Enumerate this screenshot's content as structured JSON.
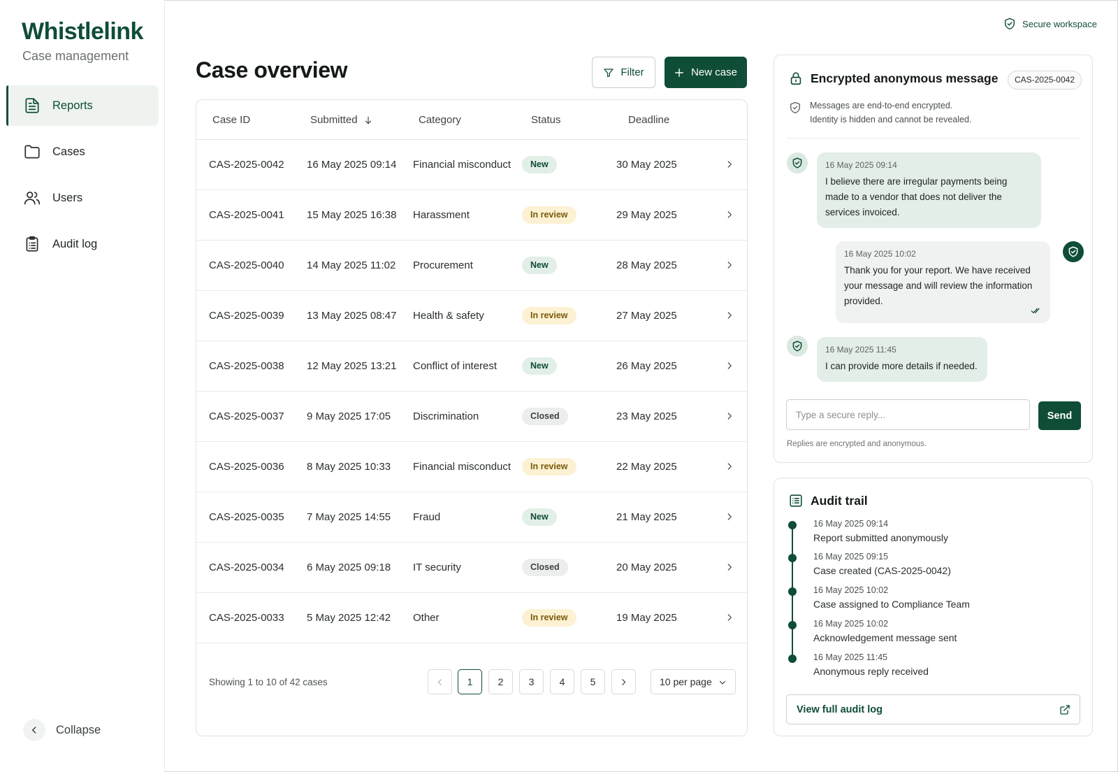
{
  "brand": {
    "name": "Whistlelink",
    "subtitle": "Case management"
  },
  "sidebar": {
    "items": [
      {
        "label": "Reports",
        "icon": "file-text-icon",
        "active": true
      },
      {
        "label": "Cases",
        "icon": "folder-icon"
      },
      {
        "label": "Users",
        "icon": "users-icon"
      },
      {
        "label": "Audit log",
        "icon": "clipboard-icon"
      }
    ],
    "collapse_label": "Collapse"
  },
  "header": {
    "secure_label": "Secure workspace"
  },
  "main": {
    "title": "Case overview",
    "filter_label": "Filter",
    "new_case_label": "New case",
    "columns": [
      "Case ID",
      "Submitted",
      "Category",
      "Status",
      "Deadline"
    ],
    "rows": [
      {
        "id": "CAS-2025-0042",
        "submitted": "16 May 2025 09:14",
        "category": "Financial misconduct",
        "status": "New",
        "deadline": "30 May 2025"
      },
      {
        "id": "CAS-2025-0041",
        "submitted": "15 May 2025 16:38",
        "category": "Harassment",
        "status": "In review",
        "deadline": "29 May 2025"
      },
      {
        "id": "CAS-2025-0040",
        "submitted": "14 May 2025 11:02",
        "category": "Procurement",
        "status": "New",
        "deadline": "28 May 2025"
      },
      {
        "id": "CAS-2025-0039",
        "submitted": "13 May 2025 08:47",
        "category": "Health & safety",
        "status": "In review",
        "deadline": "27 May 2025"
      },
      {
        "id": "CAS-2025-0038",
        "submitted": "12 May 2025 13:21",
        "category": "Conflict of interest",
        "status": "New",
        "deadline": "26 May 2025"
      },
      {
        "id": "CAS-2025-0037",
        "submitted": "9 May 2025 17:05",
        "category": "Discrimination",
        "status": "Closed",
        "deadline": "23 May 2025"
      },
      {
        "id": "CAS-2025-0036",
        "submitted": "8 May 2025 10:33",
        "category": "Financial misconduct",
        "status": "In review",
        "deadline": "22 May 2025"
      },
      {
        "id": "CAS-2025-0035",
        "submitted": "7 May 2025 14:55",
        "category": "Fraud",
        "status": "New",
        "deadline": "21 May 2025"
      },
      {
        "id": "CAS-2025-0034",
        "submitted": "6 May 2025 09:18",
        "category": "IT security",
        "status": "Closed",
        "deadline": "20 May 2025"
      },
      {
        "id": "CAS-2025-0033",
        "submitted": "5 May 2025 12:42",
        "category": "Other",
        "status": "In review",
        "deadline": "19 May 2025"
      }
    ],
    "showing": "Showing 1 to 10 of 42 cases",
    "pages": [
      "1",
      "2",
      "3",
      "4",
      "5"
    ],
    "current_page": "1",
    "per_page": "10 per page"
  },
  "messages": {
    "title": "Encrypted anonymous message",
    "case_id": "CAS-2025-0042",
    "note_line1": "Messages are end-to-end encrypted.",
    "note_line2": "Identity is hidden and cannot be revealed.",
    "thread": [
      {
        "direction": "in",
        "time": "16 May 2025 09:14",
        "text": "I believe there are irregular payments being made to a vendor that does not deliver the services invoiced."
      },
      {
        "direction": "out",
        "time": "16 May 2025 10:02",
        "text": "Thank you for your report. We have received your message and will review the information provided."
      },
      {
        "direction": "in",
        "time": "16 May 2025 11:45",
        "text": "I can provide more details if needed."
      }
    ],
    "reply_placeholder": "Type a secure reply...",
    "send_label": "Send",
    "reply_note": "Replies are encrypted and anonymous."
  },
  "audit": {
    "title": "Audit trail",
    "events": [
      {
        "time": "16 May 2025 09:14",
        "text": "Report submitted anonymously"
      },
      {
        "time": "16 May 2025 09:15",
        "text": "Case created (CAS-2025-0042)"
      },
      {
        "time": "16 May 2025 10:02",
        "text": "Case assigned to Compliance Team"
      },
      {
        "time": "16 May 2025 10:02",
        "text": "Acknowledgement message sent"
      },
      {
        "time": "16 May 2025 11:45",
        "text": "Anonymous reply received"
      }
    ],
    "view_full_label": "View full audit log"
  },
  "colors": {
    "brand": "#0f4d36",
    "new_bg": "#e2efe7",
    "review_bg": "#fcf1d2",
    "closed_bg": "#eceeed"
  }
}
